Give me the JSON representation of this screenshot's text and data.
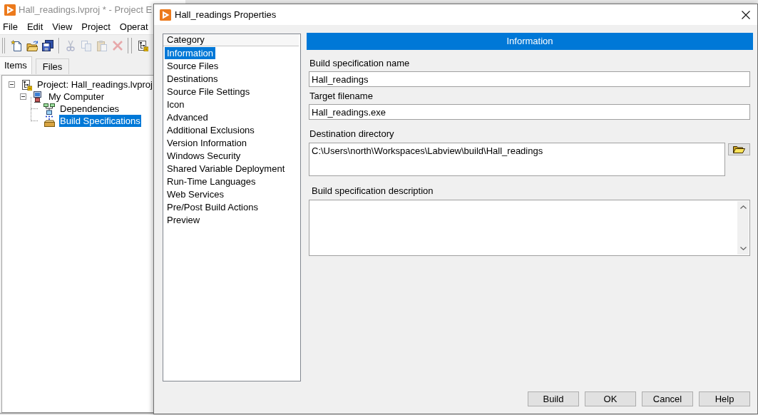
{
  "project_window": {
    "title": "Hall_readings.lvproj * - Project E",
    "menu": [
      "File",
      "Edit",
      "View",
      "Project",
      "Operat"
    ],
    "toolbar": [
      {
        "kind": "new",
        "disabled": false
      },
      {
        "kind": "open",
        "disabled": false
      },
      {
        "kind": "save_all",
        "disabled": false
      },
      {
        "kind": "separator"
      },
      {
        "kind": "cut",
        "disabled": true
      },
      {
        "kind": "copy",
        "disabled": true
      },
      {
        "kind": "paste",
        "disabled": true
      },
      {
        "kind": "delete",
        "disabled": true
      },
      {
        "kind": "grip"
      },
      {
        "kind": "project",
        "disabled": false
      }
    ],
    "tabs": [
      {
        "label": "Items",
        "selected": true
      },
      {
        "label": "Files",
        "selected": false
      }
    ],
    "tree": [
      {
        "label": "Project: Hall_readings.lvproj",
        "kind": "project",
        "selected": false,
        "expanded": true,
        "children": [
          {
            "label": "My Computer",
            "kind": "computer",
            "selected": false,
            "expanded": true,
            "children": [
              {
                "label": "Dependencies",
                "kind": "dependencies",
                "selected": false
              },
              {
                "label": "Build Specifications",
                "kind": "build",
                "selected": true
              }
            ]
          }
        ]
      }
    ]
  },
  "dialog": {
    "title": "Hall_readings Properties",
    "category_header": "Category",
    "categories": [
      {
        "label": "Information",
        "selected": true
      },
      {
        "label": "Source Files",
        "selected": false
      },
      {
        "label": "Destinations",
        "selected": false
      },
      {
        "label": "Source File Settings",
        "selected": false
      },
      {
        "label": "Icon",
        "selected": false
      },
      {
        "label": "Advanced",
        "selected": false
      },
      {
        "label": "Additional Exclusions",
        "selected": false
      },
      {
        "label": "Version Information",
        "selected": false
      },
      {
        "label": "Windows Security",
        "selected": false
      },
      {
        "label": "Shared Variable Deployment",
        "selected": false
      },
      {
        "label": "Run-Time Languages",
        "selected": false
      },
      {
        "label": "Web Services",
        "selected": false
      },
      {
        "label": "Pre/Post Build Actions",
        "selected": false
      },
      {
        "label": "Preview",
        "selected": false
      }
    ],
    "section_title": "Information",
    "fields": [
      {
        "kind": "text",
        "label": "Build specification name",
        "value": "Hall_readings"
      },
      {
        "kind": "text",
        "label": "Target filename",
        "value": "Hall_readings.exe"
      },
      {
        "kind": "path",
        "label": "Destination directory",
        "value": "C:\\Users\\north\\Workspaces\\Labview\\build\\Hall_readings"
      },
      {
        "kind": "multiline",
        "label": "Build specification description"
      }
    ],
    "buttons": [
      "Build",
      "OK",
      "Cancel",
      "Help"
    ]
  }
}
